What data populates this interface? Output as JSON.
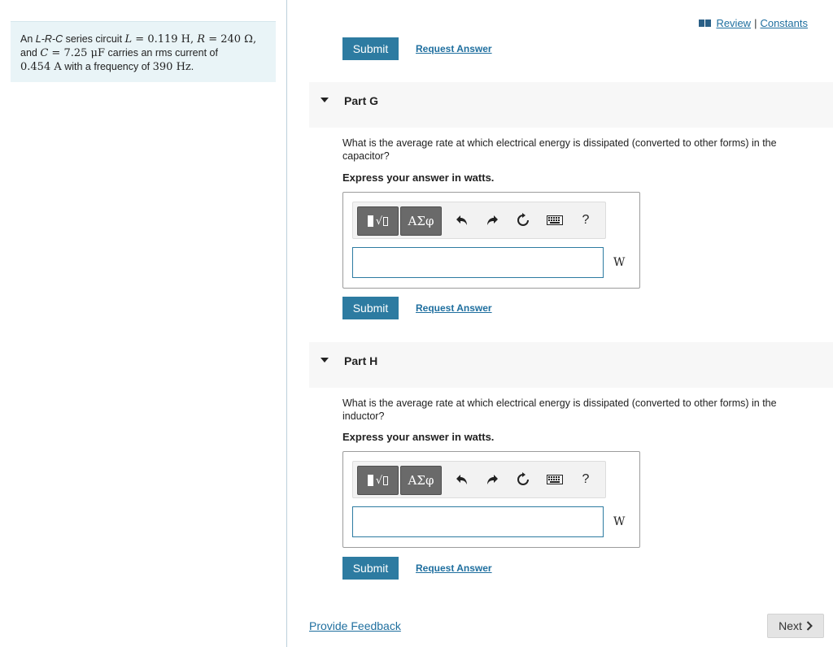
{
  "problem": {
    "p1": "An ",
    "circuit": "L-R-C",
    "p2": " series circuit ",
    "L_sym": "L",
    "L_val": " = 0.119 H, ",
    "R_sym": "R",
    "R_val": " = 240 Ω,",
    "p3": "and ",
    "C_sym": "C",
    "C_val": " = 7.25 μF",
    "p4": " carries an rms current of",
    "I_val": "0.454 A",
    "p5": " with a frequency of ",
    "f_val": "390 Hz",
    "p6": "."
  },
  "header": {
    "review_label": "Review",
    "separator": "|",
    "constants_label": "Constants"
  },
  "top": {
    "submit_label": "Submit",
    "request_label": "Request Answer"
  },
  "parts": [
    {
      "title": "Part G",
      "question": "What is the average rate at which electrical energy is dissipated (converted to other forms) in the capacitor?",
      "express": "Express your answer in watts.",
      "template1": "√",
      "template2": "ΑΣφ",
      "unit": "W",
      "help": "?",
      "answer_value": "",
      "submit_label": "Submit",
      "request_label": "Request Answer"
    },
    {
      "title": "Part H",
      "question": "What is the average rate at which electrical energy is dissipated (converted to other forms) in the inductor?",
      "express": "Express your answer in watts.",
      "template1": "√",
      "template2": "ΑΣφ",
      "unit": "W",
      "help": "?",
      "answer_value": "",
      "submit_label": "Submit",
      "request_label": "Request Answer"
    }
  ],
  "toolbar_icons": [
    "templates-icon",
    "greek-symbols-icon",
    "undo-icon",
    "redo-icon",
    "reset-icon",
    "keyboard-icon",
    "help-icon"
  ],
  "footer": {
    "feedback_label": "Provide Feedback",
    "next_label": "Next"
  },
  "colors": {
    "accent": "#2d7ba1",
    "link": "#1f6f9f",
    "problem_bg": "#e9f4f7",
    "part_header_bg": "#f7f7f7",
    "template_btn": "#6a6a6a"
  }
}
